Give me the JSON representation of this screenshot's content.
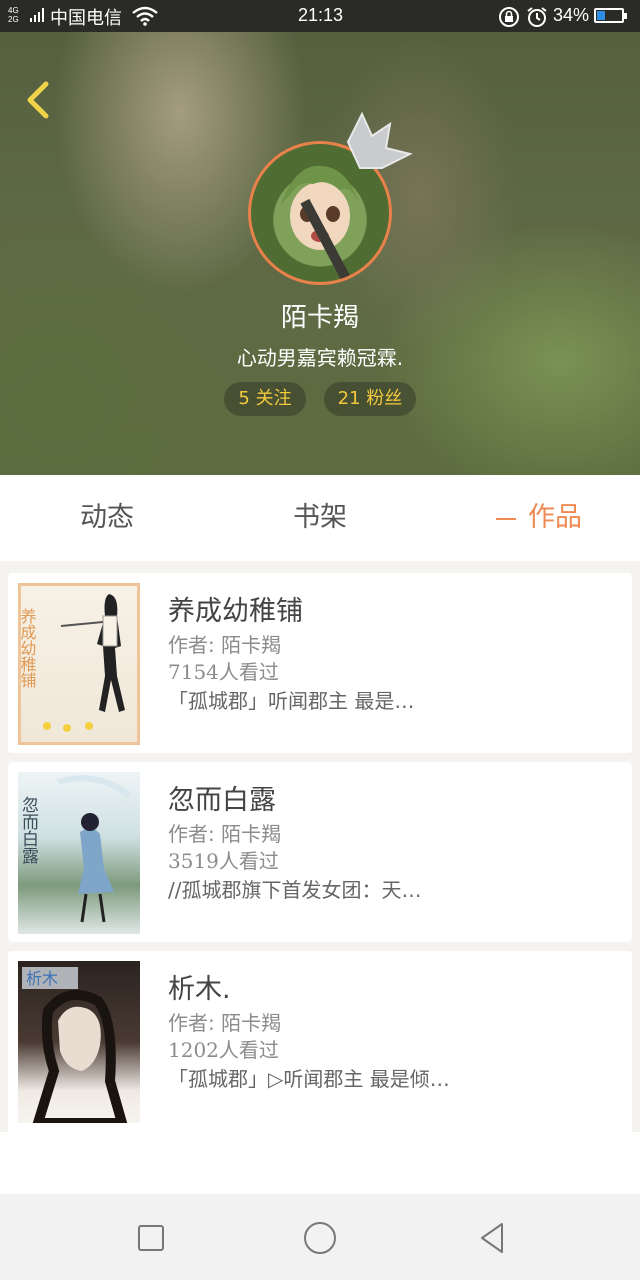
{
  "status_bar": {
    "network_top": "4G",
    "network_bottom": "2G",
    "carrier": "中国电信",
    "time": "21:13",
    "battery": "34%",
    "battery_level": 0.34,
    "icons": [
      "signal-icon",
      "wifi-icon",
      "rotation-lock-icon",
      "alarm-icon",
      "battery-icon"
    ]
  },
  "profile": {
    "username": "陌卡羯",
    "bio": "心动男嘉宾赖冠霖.",
    "following": "5 关注",
    "followers": "21 粉丝"
  },
  "tabs": [
    {
      "label": "动态",
      "active": false
    },
    {
      "label": "书架",
      "active": false
    },
    {
      "label": "作品",
      "active": true
    }
  ],
  "works": [
    {
      "title": "养成幼稚铺",
      "author": "作者: 陌卡羯",
      "reads": "7154人看过",
      "description": "「孤城郡」听闻郡主 最是…",
      "cover_text": "养成幼稚铺"
    },
    {
      "title": "忽而白露",
      "author": "作者: 陌卡羯",
      "reads": "3519人看过",
      "description": "//孤城郡旗下首发女团：天…",
      "cover_text": "忽而白露"
    },
    {
      "title": "析木.",
      "author": "作者: 陌卡羯",
      "reads": "1202人看过",
      "description": "「孤城郡」▷听闻郡主 最是倾…",
      "cover_text": "析木"
    }
  ],
  "colors": {
    "accent": "#ee8a52",
    "badge_text": "#f3c93c",
    "status_bar_bg": "#2a2b26"
  }
}
